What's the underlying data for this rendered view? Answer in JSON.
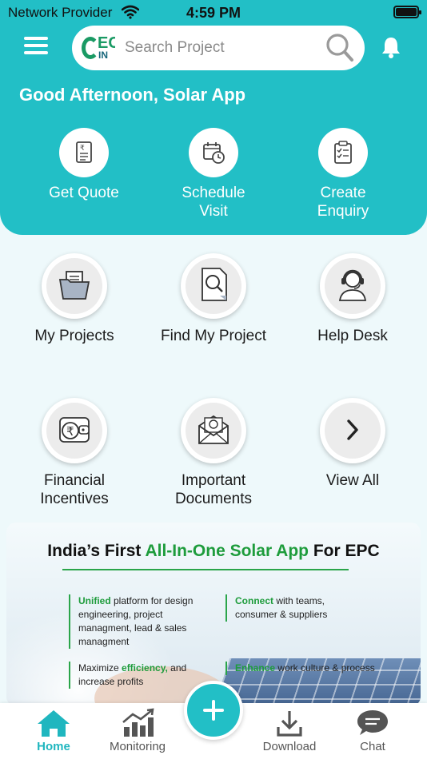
{
  "status_bar": {
    "carrier": "Network Provider",
    "time": "4:59 PM"
  },
  "search": {
    "placeholder": "Search Project",
    "logo_line1": "EC",
    "logo_line2": "IN"
  },
  "greeting": "Good Afternoon, Solar App",
  "quick_actions": [
    {
      "label": "Get Quote",
      "icon": "quote-document-icon"
    },
    {
      "label": "Schedule Visit",
      "icon": "calendar-clock-icon"
    },
    {
      "label": "Create Enquiry",
      "icon": "clipboard-checklist-icon"
    }
  ],
  "tiles": [
    {
      "label": "My Projects",
      "icon": "folder-icon"
    },
    {
      "label": "Find My Project",
      "icon": "document-search-icon"
    },
    {
      "label": "Help Desk",
      "icon": "headset-support-icon"
    },
    {
      "label": "Financial Incentives",
      "icon": "rupee-wallet-icon"
    },
    {
      "label": "Important Documents",
      "icon": "envelope-badge-icon"
    },
    {
      "label": "View All",
      "icon": "chevron-right-icon"
    }
  ],
  "banner": {
    "title_pre": "India’s First ",
    "title_hl": "All-In-One Solar App",
    "title_post": " For EPC",
    "features": [
      {
        "hl": "Unified",
        "pre": "",
        "text": " platform for design engineering, project managment, lead & sales managment"
      },
      {
        "hl": "Connect",
        "pre": "",
        "text": " with teams, consumer & suppliers"
      },
      {
        "pre": "Maximize ",
        "hl": "efficiency,",
        "text": " and increase profits"
      },
      {
        "hl": "Enhance",
        "pre": "",
        "text": " work culture & process"
      }
    ]
  },
  "bottom_nav": [
    {
      "label": "Home",
      "icon": "home-icon",
      "active": true
    },
    {
      "label": "Monitoring",
      "icon": "bar-chart-icon",
      "active": false
    },
    {
      "label": "Download",
      "icon": "download-icon",
      "active": false
    },
    {
      "label": "Chat",
      "icon": "chat-icon",
      "active": false
    }
  ],
  "colors": {
    "primary": "#22bfc6",
    "accent_green": "#1e9c3c",
    "background": "#eef9fb"
  }
}
